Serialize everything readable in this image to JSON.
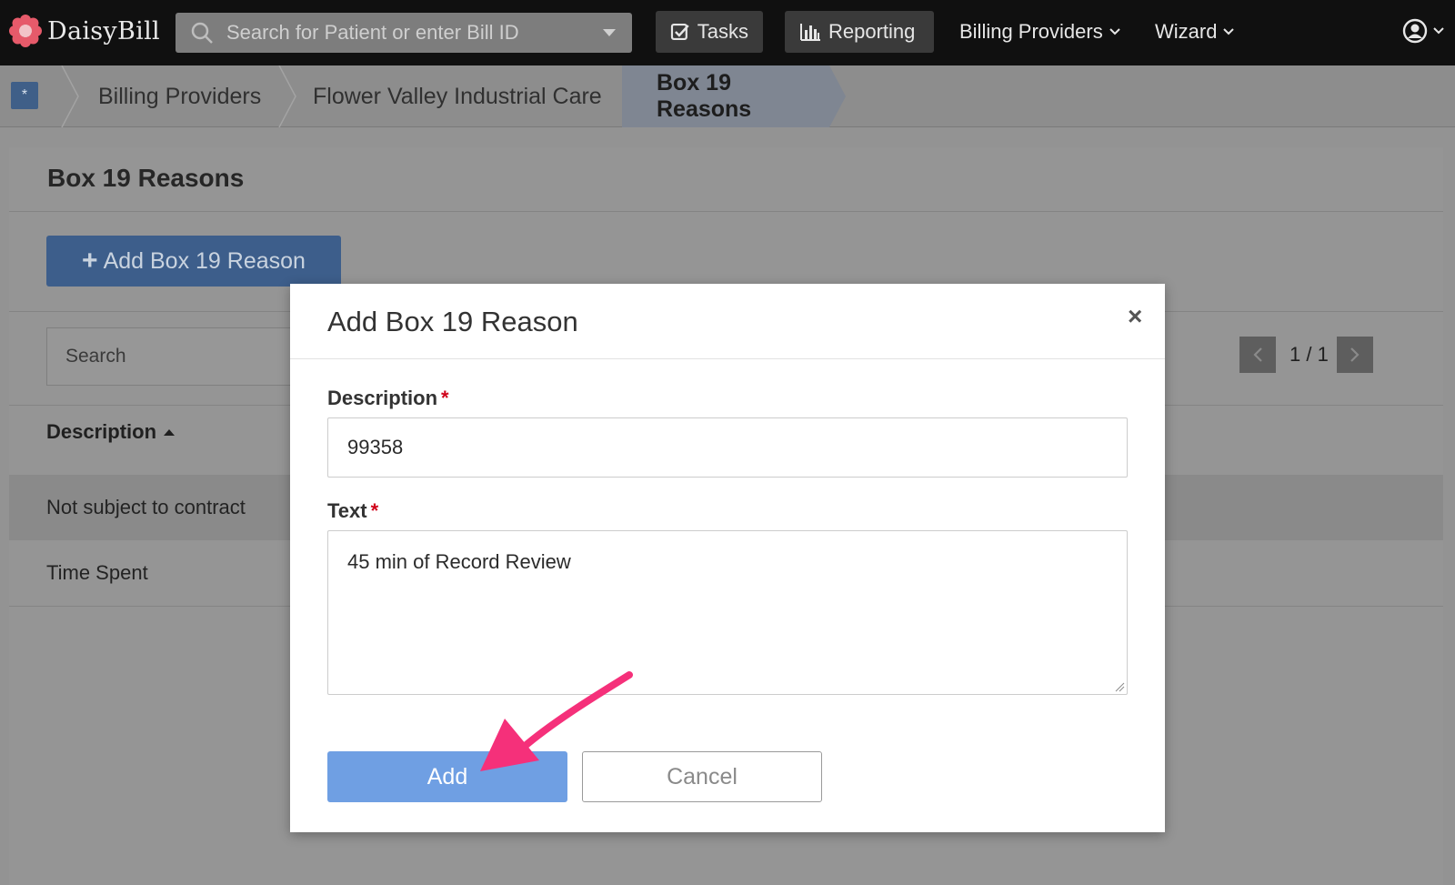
{
  "navbar": {
    "logo_text": "DaisyBill",
    "search_placeholder": "Search for Patient or enter Bill ID",
    "tasks_label": "Tasks",
    "reporting_label": "Reporting",
    "billing_providers_label": "Billing Providers",
    "wizard_label": "Wizard"
  },
  "breadcrumb": {
    "items": [
      "Billing Providers",
      "Flower Valley Industrial Care",
      "Box 19 Reasons"
    ]
  },
  "page": {
    "title": "Box 19 Reasons",
    "add_button_label": "Add Box 19 Reason",
    "search_placeholder": "Search",
    "pager_text": "1 / 1",
    "column_header": "Description",
    "rows": [
      "Not subject to contract",
      "Time Spent"
    ]
  },
  "modal": {
    "title": "Add Box 19 Reason",
    "close_symbol": "×",
    "description_label": "Description",
    "description_value": "99358",
    "text_label": "Text",
    "text_value": "45 min of Record Review",
    "required_mark": "*",
    "add_label": "Add",
    "cancel_label": "Cancel"
  },
  "colors": {
    "primary_button": "#6f9fe3",
    "annotation_arrow": "#f5307a",
    "required": "#d0021b"
  },
  "icons": [
    "daisy-logo-icon",
    "search-icon",
    "checkbox-icon",
    "bar-chart-icon",
    "chevron-down-icon",
    "user-icon",
    "home-icon",
    "chevron-left-icon",
    "chevron-right-icon",
    "close-icon",
    "plus-icon",
    "sort-up-icon",
    "resize-handle-icon"
  ]
}
